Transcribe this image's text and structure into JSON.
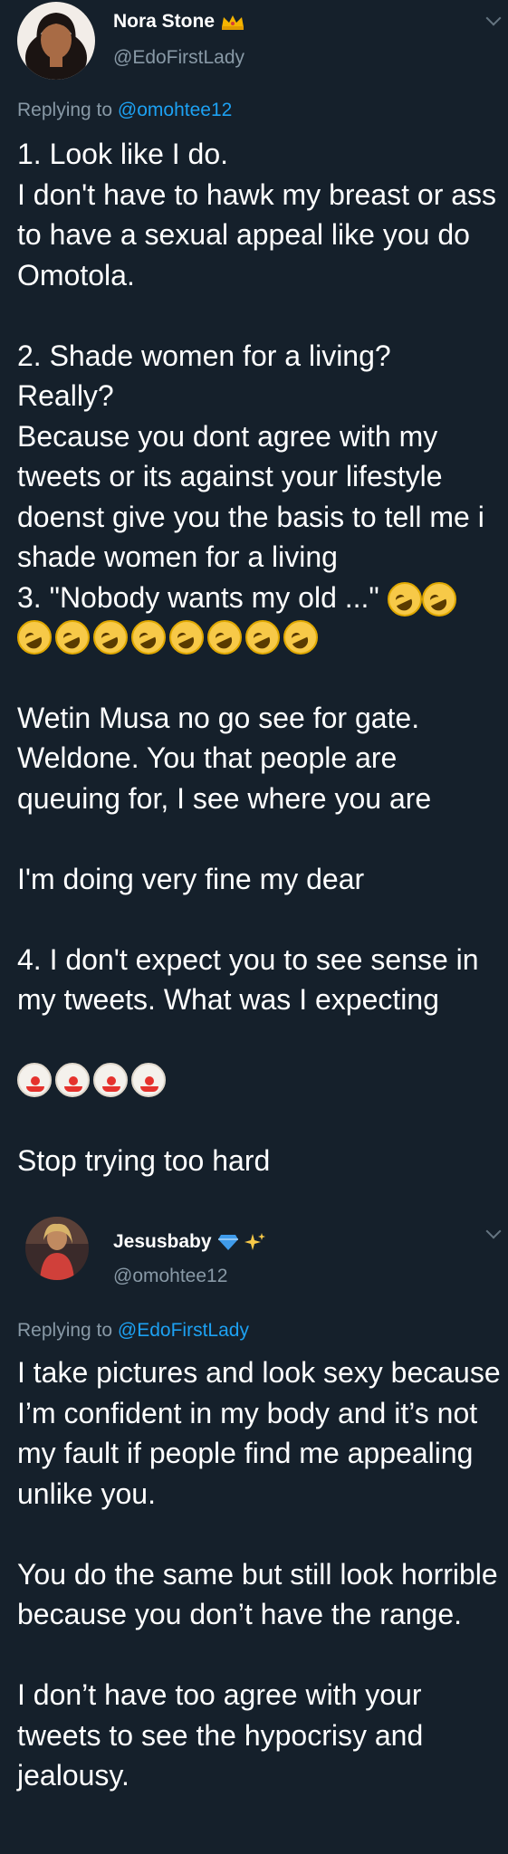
{
  "tweet1": {
    "author_name": "Nora Stone",
    "handle": "@EdoFirstLady",
    "replying_prefix": "Replying to",
    "replying_to": "@omohtee12",
    "name_badge_icon": "crown-icon",
    "paragraphs": [
      "1. Look like I do.\nI don't have to hawk my breast or ass to have a sexual appeal like you do Omotola.",
      "2. Shade women for a living?\nReally?\nBecause you dont agree with my tweets or its against your lifestyle doenst give you the basis to tell me i shade women for a living\n3. \"Nobody wants my old ...\"",
      "Wetin Musa no go see for gate. Weldone. You that people are queuing for, I see where you are",
      "I'm doing very fine my dear",
      "4. I don't expect you to see sense in my tweets. What was I expecting",
      "Stop trying too hard"
    ],
    "emoji": {
      "rolling_laughing": "rolling-on-floor-laughing-emoji",
      "clown": "clown-face-emoji"
    }
  },
  "tweet2": {
    "author_name": "Jesusbaby",
    "name_badge_icons": [
      "blue-diamond-icon",
      "sparkles-icon"
    ],
    "handle": "@omohtee12",
    "replying_prefix": "Replying to",
    "replying_to": "@EdoFirstLady",
    "paragraphs": [
      "I take pictures and look sexy because I’m confident in my body and it’s not my fault if people find me appealing unlike you.",
      "You do the same but still look horrible because you don’t have the range.",
      "I don’t have too agree with your tweets to see the hypocrisy and jealousy."
    ]
  },
  "colors": {
    "background": "#15202b",
    "text": "#ffffff",
    "secondary": "#8899a6",
    "link": "#1da1f2"
  }
}
